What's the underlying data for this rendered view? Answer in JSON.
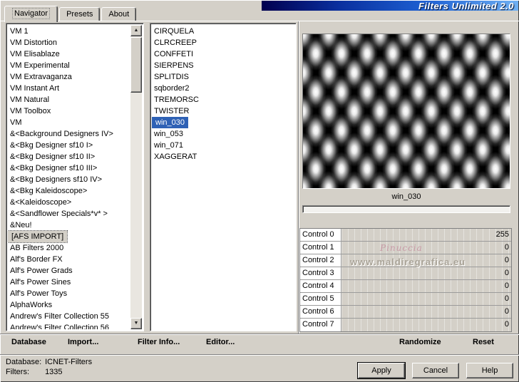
{
  "window": {
    "title": "Filters Unlimited 2.0"
  },
  "tabs": {
    "items": [
      "Navigator",
      "Presets",
      "About"
    ],
    "active_index": 0
  },
  "icons": {
    "scroll_up": "▲",
    "scroll_down": "▼"
  },
  "categories": {
    "items": [
      "VM 1",
      "VM Distortion",
      "VM Elisablaze",
      "VM Experimental",
      "VM Extravaganza",
      "VM Instant Art",
      "VM Natural",
      "VM Toolbox",
      "VM",
      "&<Background Designers IV>",
      "&<Bkg Designer sf10 I>",
      "&<Bkg Designer sf10 II>",
      "&<Bkg Designer sf10 III>",
      "&<Bkg Designers sf10 IV>",
      "&<Bkg Kaleidoscope>",
      "&<Kaleidoscope>",
      "&<Sandflower Specials*v* >",
      "&Neu!",
      "[AFS IMPORT]",
      "AB Filters 2000",
      "Alf's Border FX",
      "Alf's Power Grads",
      "Alf's Power Sines",
      "Alf's Power Toys",
      "AlphaWorks",
      "Andrew's Filter Collection 55",
      "Andrew's Filter Collection 56"
    ],
    "focused_index": 18
  },
  "filters": {
    "items": [
      "CIRQUELA",
      "CLRCREEP",
      "CONFFETI",
      "SIERPENS",
      "SPLITDIS",
      "sqborder2",
      "TREMORSC",
      "TWISTER",
      "win_030",
      "win_053",
      "win_071",
      "XAGGERAT"
    ],
    "selected_index": 8
  },
  "preview": {
    "label": "win_030"
  },
  "controls": [
    {
      "label": "Control 0",
      "value": "255"
    },
    {
      "label": "Control 1",
      "value": "0"
    },
    {
      "label": "Control 2",
      "value": "0"
    },
    {
      "label": "Control 3",
      "value": "0"
    },
    {
      "label": "Control 4",
      "value": "0"
    },
    {
      "label": "Control 5",
      "value": "0"
    },
    {
      "label": "Control 6",
      "value": "0"
    },
    {
      "label": "Control 7",
      "value": "0"
    }
  ],
  "watermark": {
    "line1": "Pinuccia",
    "line2": "www.maldiregrafica.eu"
  },
  "actions": {
    "database": "Database",
    "import": "Import...",
    "filter_info": "Filter Info...",
    "editor": "Editor...",
    "randomize": "Randomize",
    "reset": "Reset"
  },
  "status": {
    "database_label": "Database:",
    "database_value": "ICNET-Filters",
    "filters_label": "Filters:",
    "filters_value": "1335"
  },
  "buttons": {
    "apply": "Apply",
    "cancel": "Cancel",
    "help": "Help"
  },
  "colors": {
    "selection": "#2e61b5",
    "titlebar_start": "#00004f",
    "titlebar_end": "#6fb0f2"
  }
}
